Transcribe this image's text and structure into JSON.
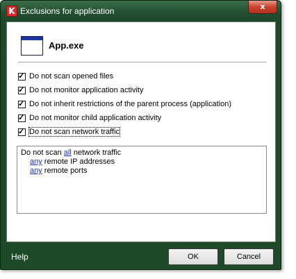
{
  "window": {
    "title": "Exclusions for application",
    "close_label": "x"
  },
  "app": {
    "name": "App.exe"
  },
  "options": [
    {
      "label": "Do not scan opened files",
      "checked": true
    },
    {
      "label": "Do not monitor application activity",
      "checked": true
    },
    {
      "label": "Do not inherit restrictions of the parent process (application)",
      "checked": true
    },
    {
      "label": "Do not monitor child application activity",
      "checked": true
    },
    {
      "label": "Do not scan network traffic",
      "checked": true
    }
  ],
  "details": {
    "line1_prefix": "Do not scan ",
    "line1_link": "all",
    "line1_suffix": " network traffic",
    "line2_link": "any",
    "line2_suffix": " remote IP addresses",
    "line3_link": "any",
    "line3_suffix": " remote ports"
  },
  "footer": {
    "help_label": "Help",
    "ok_label": "OK",
    "cancel_label": "Cancel"
  },
  "colors": {
    "frame": "#1e4a2a",
    "close_button": "#c8432f",
    "link": "#1a2fc4"
  },
  "icons": {
    "app_icon": "kaspersky-k-icon",
    "exe_icon": "application-window-icon",
    "checkbox_mark": "✓"
  }
}
